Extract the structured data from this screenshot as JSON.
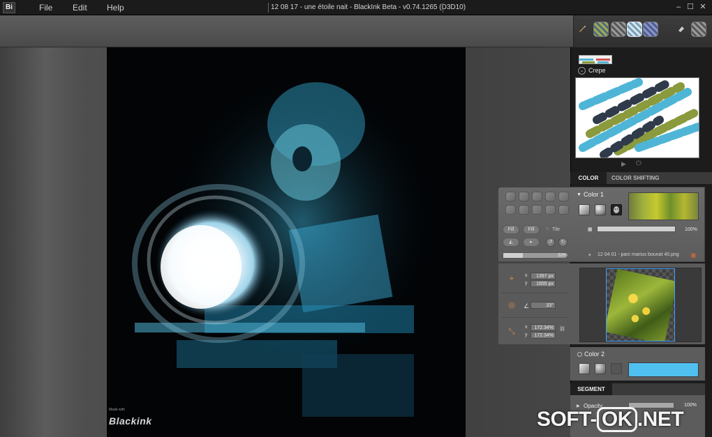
{
  "app": {
    "logo_text": "Bi",
    "window_title": "12 08 17 - une étoile nait - BlackInk Beta - v0.74.1265 (D3D10)"
  },
  "menu": {
    "items": [
      {
        "label": "File"
      },
      {
        "label": "Edit"
      },
      {
        "label": "Help"
      }
    ]
  },
  "window_controls": {
    "minimize": "–",
    "maximize": "☐",
    "close": "✕"
  },
  "brush_panel": {
    "selected_brush_name": "Crepe"
  },
  "tabs": {
    "color": "COLOR",
    "color_shifting": "COLOR SHIFTING"
  },
  "color1": {
    "label": "Color 1",
    "fill_button_1": "Fill",
    "fill_button_2": "Fill",
    "tile_label": "Tile",
    "opacity_value": "100%",
    "secondary_slider_value": "33%",
    "texture_file": "12 04 01 - parc marius bounat 40.png"
  },
  "transform": {
    "position": {
      "x_label": "x",
      "x_value": "1397 px",
      "y_label": "y",
      "y_value": "1655 px"
    },
    "angle": {
      "value": "33°"
    },
    "scale": {
      "x_label": "x",
      "x_value": "172.34%",
      "y_label": "y",
      "y_value": "172.34%"
    }
  },
  "color2": {
    "label": "Color 2",
    "swatch_color": "#4fc0f0"
  },
  "segment": {
    "tab_label": "SEGMENT",
    "opacity_label": "Opacity",
    "opacity_value": "100%"
  },
  "canvas": {
    "logo_text": "Blackink",
    "logo_sub": "Made with"
  },
  "watermark": {
    "prefix": "SOFT-",
    "boxed": "OK",
    "suffix": ".NET"
  },
  "colors": {
    "accent_blue": "#3ea0ff",
    "panel_dark": "#1c1c1c",
    "panel_mid": "#5c5c5c"
  }
}
